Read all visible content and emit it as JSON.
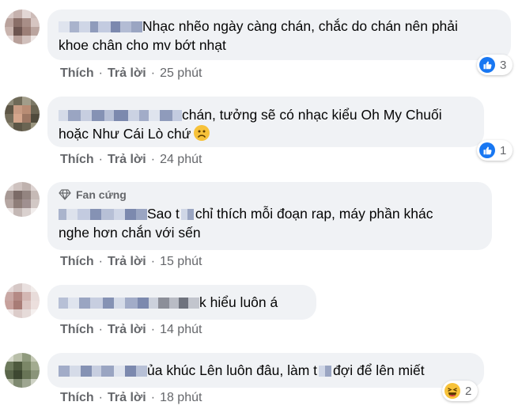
{
  "comments": [
    {
      "lines": [
        "Nhạc nhẽo ngày càng chán, chắc do chán nên phải",
        "khoe chân cho mv bớt nhạt"
      ],
      "actions": {
        "like": "Thích",
        "reply": "Trả lời",
        "time": "25 phút"
      },
      "reaction": {
        "icon": "like-icon",
        "count": "3"
      }
    },
    {
      "lines": [
        "chán, tưởng sẽ có nhạc kiểu Oh My Chuối",
        "hoặc Như Cái Lò chứ"
      ],
      "actions": {
        "like": "Thích",
        "reply": "Trả lời",
        "time": "24 phút"
      },
      "reaction": {
        "icon": "like-icon",
        "count": "1"
      }
    },
    {
      "badge": "Fan cứng",
      "lines": [
        "Sao t",
        "chỉ thích mỗi đoạn rap, máy phần khác",
        "nghe hơn chắn với sến"
      ],
      "actions": {
        "like": "Thích",
        "reply": "Trả lời",
        "time": "15 phút"
      }
    },
    {
      "lines": [
        "k hiểu luôn á"
      ],
      "actions": {
        "like": "Thích",
        "reply": "Trả lời",
        "time": "14 phút"
      }
    },
    {
      "lines": [
        "ủa khúc Lên luôn đâu, làm t",
        "đợi để lên miết"
      ],
      "actions": {
        "like": "Thích",
        "reply": "Trả lời",
        "time": "18 phút"
      },
      "reaction": {
        "icon": "haha-icon",
        "count": "2"
      }
    }
  ],
  "colors": {
    "bubble": "#f0f2f5",
    "meta": "#65676b",
    "like_blue": "#1877f2",
    "haha_yellow": "#f7c23a"
  }
}
